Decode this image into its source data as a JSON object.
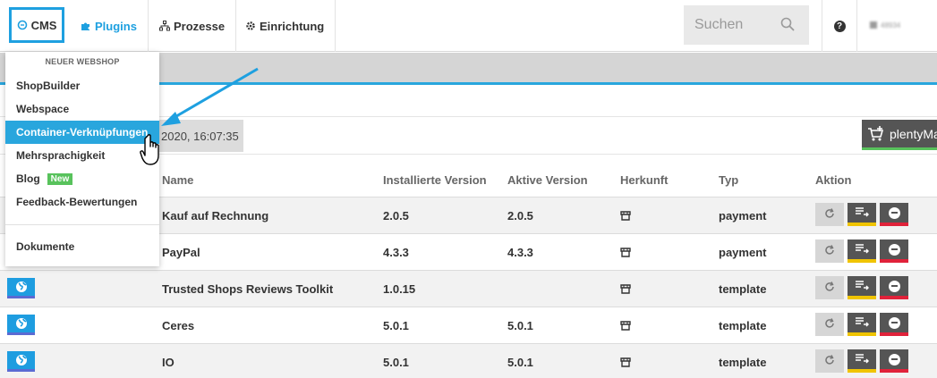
{
  "nav": {
    "cms_label": "CMS",
    "plugins_label": "Plugins",
    "prozesse_label": "Prozesse",
    "einrichtung_label": "Einrichtung",
    "search_placeholder": "Suchen",
    "help_label": "?",
    "user_label": "48934"
  },
  "dropdown": {
    "heading": "NEUER WEBSHOP",
    "items": [
      {
        "label": "ShopBuilder"
      },
      {
        "label": "Webspace"
      },
      {
        "label": "Container-Verknüpfungen"
      },
      {
        "label": "Mehrsprachigkeit"
      },
      {
        "label": "Blog",
        "badge": "New"
      },
      {
        "label": "Feedback-Bewertungen"
      },
      {
        "label": "Dokumente"
      }
    ]
  },
  "toolbar": {
    "date_text": "2020, 16:07:35",
    "plenty_button": "plentyMa"
  },
  "table": {
    "columns": [
      "Name",
      "Installierte Version",
      "Aktive Version",
      "Herkunft",
      "Typ",
      "Aktion"
    ],
    "rows": [
      {
        "name": "Kauf auf Rechnung",
        "installed": "2.0.5",
        "active": "2.0.5",
        "type": "payment"
      },
      {
        "name": "PayPal",
        "installed": "4.3.3",
        "active": "4.3.3",
        "type": "payment"
      },
      {
        "name": "Trusted Shops Reviews Toolkit",
        "installed": "1.0.15",
        "active": "",
        "type": "template"
      },
      {
        "name": "Ceres",
        "installed": "5.0.1",
        "active": "5.0.1",
        "type": "template"
      },
      {
        "name": "IO",
        "installed": "5.0.1",
        "active": "5.0.1",
        "type": "template"
      }
    ]
  },
  "colors": {
    "accent": "#29a6dd",
    "plenty_green": "#58c25c",
    "warning_yellow": "#f0c400",
    "danger_red": "#e0223a"
  },
  "icons": [
    "cms-icon",
    "puzzle-icon",
    "sitemap-icon",
    "gear-icon",
    "search-icon",
    "help-icon",
    "cart-plus-icon",
    "globe-icon",
    "marketplace-icon",
    "refresh-icon",
    "list-icon",
    "minus-circle-icon",
    "hand-cursor-icon",
    "arrow-annotation"
  ]
}
